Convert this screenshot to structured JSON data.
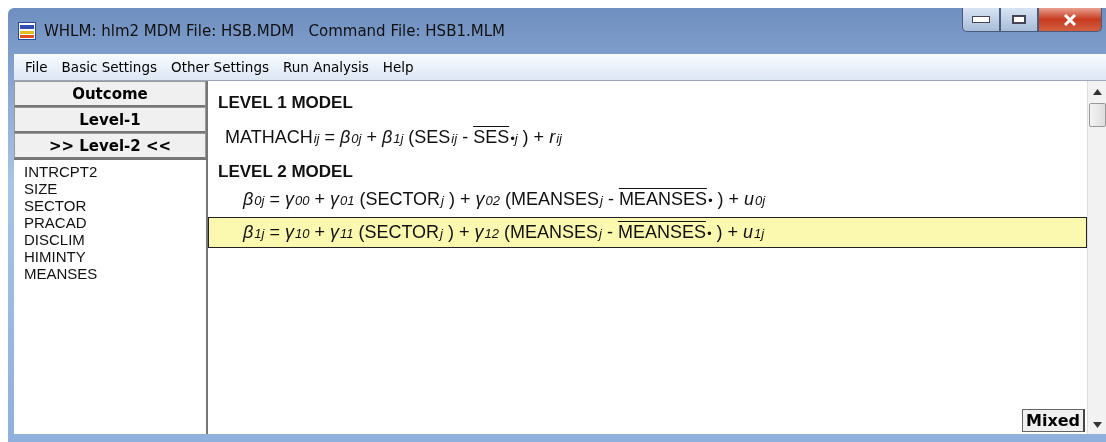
{
  "window": {
    "title": "WHLM: hlm2 MDM File: HSB.MDM   Command File: HSB1.MLM"
  },
  "menu": [
    "File",
    "Basic Settings",
    "Other Settings",
    "Run Analysis",
    "Help"
  ],
  "sidebar": {
    "buttons": [
      "Outcome",
      "Level-1",
      ">> Level-2 <<"
    ],
    "variables": [
      "INTRCPT2",
      "SIZE",
      "SECTOR",
      "PRACAD",
      "DISCLIM",
      "HIMINTY",
      "MEANSES"
    ]
  },
  "level1": {
    "heading": "LEVEL 1 MODEL",
    "equation": [
      {
        "text": "MATHACH",
        "sub": "ij"
      },
      {
        "text": "="
      },
      {
        "text": "β",
        "sub": "0j",
        "italic": true
      },
      {
        "text": "+"
      },
      {
        "text": "β",
        "sub": "1j",
        "italic": true
      },
      {
        "text": "(SES",
        "sub": "ij"
      },
      {
        "text": "-"
      },
      {
        "text": "SES",
        "sub": "•j",
        "bar": true
      },
      {
        "text": ") +"
      },
      {
        "text": "r",
        "sub": "ij",
        "italic": true
      }
    ]
  },
  "level2": {
    "heading": "LEVEL 2 MODEL",
    "equations": [
      {
        "selected": false,
        "terms": [
          {
            "text": "β",
            "sub": "0j",
            "italic": true
          },
          {
            "text": "="
          },
          {
            "text": "γ",
            "sub": "00",
            "italic": true
          },
          {
            "text": "+"
          },
          {
            "text": "γ",
            "sub": "01",
            "italic": true
          },
          {
            "text": "(SECTOR",
            "sub": "j"
          },
          {
            "text": ") +"
          },
          {
            "text": "γ",
            "sub": "02",
            "italic": true
          },
          {
            "text": "(MEANSES",
            "sub": "j"
          },
          {
            "text": "-"
          },
          {
            "text": "MEANSES",
            "sub": "•",
            "bar": true
          },
          {
            "text": ") +"
          },
          {
            "text": "u",
            "sub": "0j",
            "italic": true
          }
        ]
      },
      {
        "selected": true,
        "terms": [
          {
            "text": "β",
            "sub": "1j",
            "italic": true
          },
          {
            "text": "="
          },
          {
            "text": "γ",
            "sub": "10",
            "italic": true
          },
          {
            "text": "+"
          },
          {
            "text": "γ",
            "sub": "11",
            "italic": true
          },
          {
            "text": "(SECTOR",
            "sub": "j"
          },
          {
            "text": ") +"
          },
          {
            "text": "γ",
            "sub": "12",
            "italic": true
          },
          {
            "text": "(MEANSES",
            "sub": "j"
          },
          {
            "text": "-"
          },
          {
            "text": "MEANSES",
            "sub": "•",
            "bar": true
          },
          {
            "text": ") +"
          },
          {
            "text": "u",
            "sub": "1j",
            "italic": true
          }
        ]
      }
    ]
  },
  "mixed_button": "Mixed"
}
